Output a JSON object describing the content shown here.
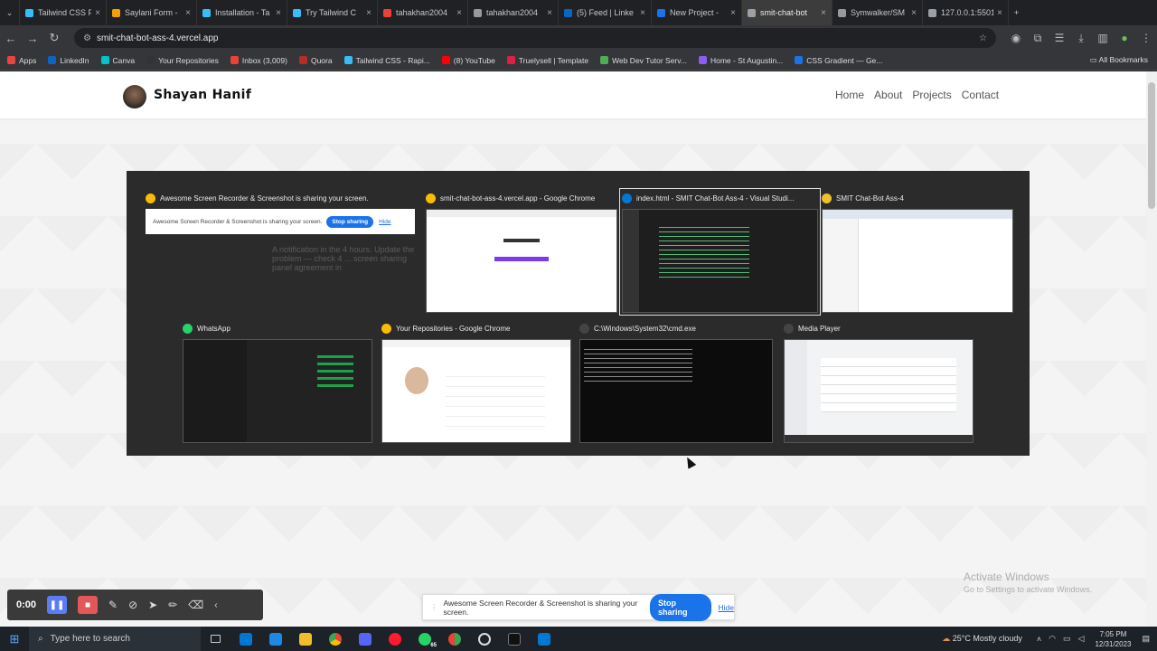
{
  "browser": {
    "tabs": [
      {
        "title": "Tailwind CSS F",
        "color": "#38bdf8"
      },
      {
        "title": "Saylani Form -",
        "color": "#f59e0b"
      },
      {
        "title": "Installation - Ta",
        "color": "#38bdf8"
      },
      {
        "title": "Try Tailwind C",
        "color": "#38bdf8"
      },
      {
        "title": "tahakhan2004",
        "color": "#ea4335"
      },
      {
        "title": "tahakhan2004",
        "color": "#999999"
      },
      {
        "title": "(5) Feed | Linke",
        "color": "#0a66c2"
      },
      {
        "title": "New Project -",
        "color": "#1a73e8"
      },
      {
        "title": "smit-chat-bot",
        "color": "#9aa0a6"
      },
      {
        "title": "Symwalker/SM",
        "color": "#999999"
      },
      {
        "title": "127.0.0.1:5501",
        "color": "#9aa0a6"
      }
    ],
    "active_tab_index": 8,
    "url": "smit-chat-bot-ass-4.vercel.app",
    "bookmarks": [
      {
        "label": "Apps",
        "color": "#e8453c"
      },
      {
        "label": "LinkedIn",
        "color": "#0a66c2"
      },
      {
        "label": "Canva",
        "color": "#00c4cc"
      },
      {
        "label": "Your Repositories",
        "color": "#333333"
      },
      {
        "label": "Inbox (3,009)",
        "color": "#ea4335"
      },
      {
        "label": "Quora",
        "color": "#b92b27"
      },
      {
        "label": "Tailwind CSS - Rapi...",
        "color": "#38bdf8"
      },
      {
        "label": "(8) YouTube",
        "color": "#ff0000"
      },
      {
        "label": "Truelysell | Template",
        "color": "#e11d48"
      },
      {
        "label": "Web Dev Tutor Serv...",
        "color": "#4caf50"
      },
      {
        "label": "Home - St Augustin...",
        "color": "#8b5cf6"
      },
      {
        "label": "CSS Gradient — Ge...",
        "color": "#1a73e8"
      }
    ],
    "all_bookmarks": "All Bookmarks"
  },
  "site": {
    "name": "Shayan Hanif",
    "nav": [
      "Home",
      "About",
      "Projects",
      "Contact"
    ]
  },
  "share_picker": {
    "windows": [
      {
        "title": "Awesome Screen Recorder & Screenshot is sharing your screen.",
        "icon_color": "#fbbc04",
        "ghost_text": "A notification in the 4 hours. Update the problem — check 4 ... screen sharing panel agreement in"
      },
      {
        "title": "smit-chat-bot-ass-4.vercel.app - Google Chrome",
        "icon_color": "#fbbc04"
      },
      {
        "title": "index.html - SMIT Chat-Bot Ass-4 - Visual Studi...",
        "icon_color": "#0078d4"
      },
      {
        "title": "SMIT Chat-Bot Ass-4",
        "icon_color": "#f0c02c"
      },
      {
        "title": "WhatsApp",
        "icon_color": "#25d366"
      },
      {
        "title": "Your Repositories - Google Chrome",
        "icon_color": "#fbbc04"
      },
      {
        "title": "C:\\Windows\\System32\\cmd.exe",
        "icon_color": "#444444"
      },
      {
        "title": "Media Player",
        "icon_color": "#444444"
      }
    ],
    "notice_text": "Awesome Screen Recorder & Screenshot is sharing your screen.",
    "notice_stop": "Stop sharing",
    "notice_hide": "Hide"
  },
  "watermark": {
    "line1": "Activate Windows",
    "line2": "Go to Settings to activate Windows."
  },
  "recorder": {
    "time": "0:00"
  },
  "share_bar": {
    "text": "Awesome Screen Recorder & Screenshot is sharing your screen.",
    "stop": "Stop sharing",
    "hide": "Hide"
  },
  "taskbar": {
    "search_placeholder": "Type here to search",
    "whatsapp_badge": "65",
    "weather": "25°C Mostly cloudy",
    "time": "7:05 PM",
    "date": "12/31/2023"
  }
}
